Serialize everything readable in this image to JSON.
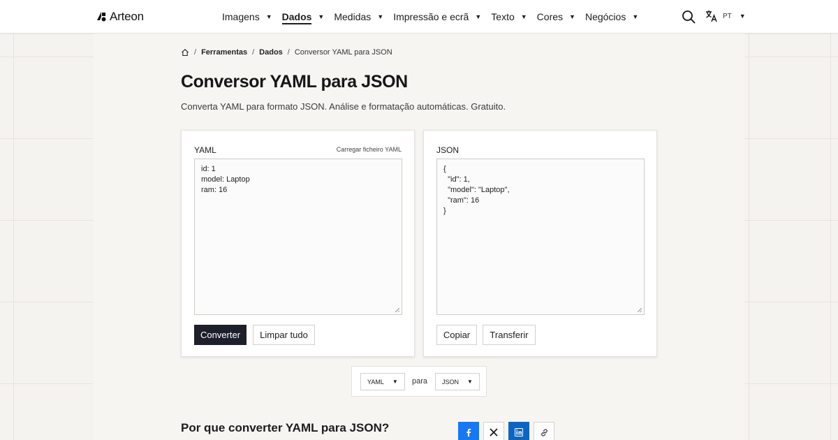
{
  "brand": {
    "name": "Arteon"
  },
  "nav": {
    "items": [
      {
        "label": "Imagens"
      },
      {
        "label": "Dados"
      },
      {
        "label": "Medidas"
      },
      {
        "label": "Impressão e ecrã"
      },
      {
        "label": "Texto"
      },
      {
        "label": "Cores"
      },
      {
        "label": "Negócios"
      }
    ],
    "active": "Dados",
    "language": "PT"
  },
  "breadcrumb": {
    "items": [
      {
        "label": "Ferramentas"
      },
      {
        "label": "Dados"
      },
      {
        "label": "Conversor YAML para JSON"
      }
    ]
  },
  "page": {
    "title": "Conversor YAML para JSON",
    "description": "Converta YAML para formato JSON. Análise e formatação automáticas. Gratuito."
  },
  "input_panel": {
    "title": "YAML",
    "upload_link": "Carregar ficheiro YAML",
    "content": "id: 1\nmodel: Laptop\nram: 16",
    "convert_label": "Converter",
    "clear_label": "Limpar tudo"
  },
  "output_panel": {
    "title": "JSON",
    "content": "{\n  \"id\": 1,\n  \"model\": \"Laptop\",\n  \"ram\": 16\n}",
    "copy_label": "Copiar",
    "download_label": "Transferir"
  },
  "format_bar": {
    "from": "YAML",
    "connector": "para",
    "to": "JSON"
  },
  "section": {
    "why_title": "Por que converter YAML para JSON?"
  },
  "share": {
    "icons": [
      "facebook-icon",
      "x-icon",
      "linkedin-icon",
      "link-icon"
    ]
  },
  "colors": {
    "primary_button": "#1d1f2b",
    "facebook": "#1877f2",
    "linkedin": "#0a66c2"
  }
}
